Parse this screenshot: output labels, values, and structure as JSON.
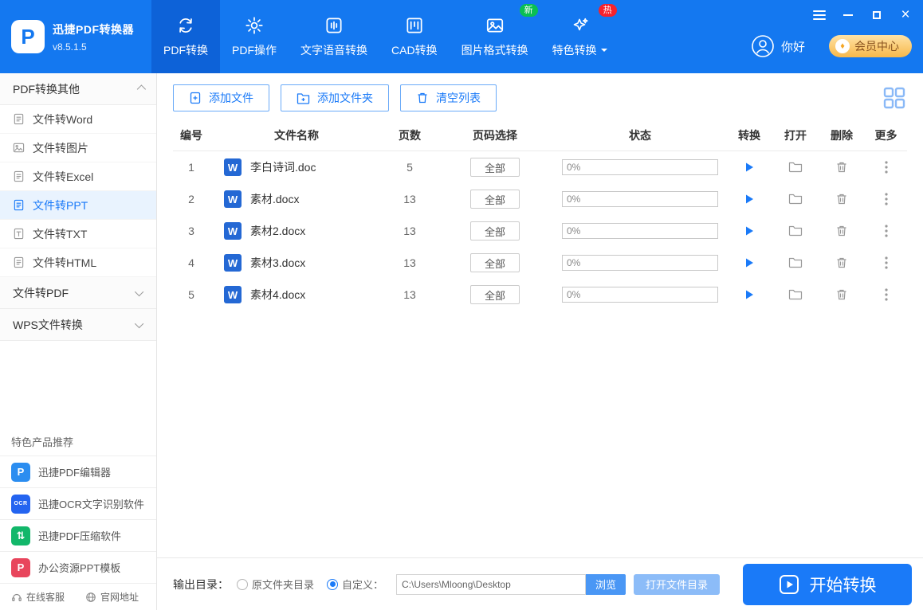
{
  "app": {
    "title": "迅捷PDF转换器",
    "version": "v8.5.1.5",
    "logo_letter": "P"
  },
  "header": {
    "tabs": [
      {
        "label": "PDF转换"
      },
      {
        "label": "PDF操作"
      },
      {
        "label": "文字语音转换"
      },
      {
        "label": "CAD转换"
      },
      {
        "label": "图片格式转换",
        "badge": "新"
      },
      {
        "label": "特色转换",
        "badge": "热"
      }
    ],
    "greeting": "你好",
    "vip_label": "会员中心"
  },
  "sidebar": {
    "sections": [
      {
        "label": "PDF转换其他",
        "items": [
          "文件转Word",
          "文件转图片",
          "文件转Excel",
          "文件转PPT",
          "文件转TXT",
          "文件转HTML"
        ]
      },
      {
        "label": "文件转PDF"
      },
      {
        "label": "WPS文件转换"
      }
    ],
    "recommend_title": "特色产品推荐",
    "recommend": [
      {
        "label": "迅捷PDF编辑器",
        "icon_text": "P"
      },
      {
        "label": "迅捷OCR文字识别软件",
        "icon_text": "OCR"
      },
      {
        "label": "迅捷PDF压缩软件",
        "icon_text": "⇅"
      },
      {
        "label": "办公资源PPT模板",
        "icon_text": "P"
      }
    ],
    "footer_links": [
      {
        "label": "在线客服"
      },
      {
        "label": "官网地址"
      }
    ]
  },
  "toolbar": {
    "add_file": "添加文件",
    "add_folder": "添加文件夹",
    "clear_list": "清空列表"
  },
  "table": {
    "headers": [
      "编号",
      "文件名称",
      "页数",
      "页码选择",
      "状态",
      "转换",
      "打开",
      "删除",
      "更多"
    ],
    "rows": [
      {
        "no": "1",
        "icon": "W",
        "name": "李白诗词.doc",
        "pages": "5",
        "range": "全部",
        "progress": "0%"
      },
      {
        "no": "2",
        "icon": "W",
        "name": "素材.docx",
        "pages": "13",
        "range": "全部",
        "progress": "0%"
      },
      {
        "no": "3",
        "icon": "W",
        "name": "素材2.docx",
        "pages": "13",
        "range": "全部",
        "progress": "0%"
      },
      {
        "no": "4",
        "icon": "W",
        "name": "素材3.docx",
        "pages": "13",
        "range": "全部",
        "progress": "0%"
      },
      {
        "no": "5",
        "icon": "W",
        "name": "素材4.docx",
        "pages": "13",
        "range": "全部",
        "progress": "0%"
      }
    ]
  },
  "output_bar": {
    "label": "输出目录：",
    "radio_original": "原文件夹目录",
    "radio_custom": "自定义：",
    "path": "C:\\Users\\Mloong\\Desktop",
    "browse": "浏览",
    "open_dir": "打开文件目录",
    "start": "开始转换"
  },
  "icons": {
    "close": "×",
    "vip_gem": "♦"
  },
  "colors": {
    "header_blue": "#1478f0",
    "active_tab": "#0d62d8",
    "accent": "#1a7af8",
    "badge_new": "#0abf53",
    "badge_hot": "#f5222d",
    "word_blue": "#2468d4",
    "vip_gold": "#f7b84a"
  }
}
